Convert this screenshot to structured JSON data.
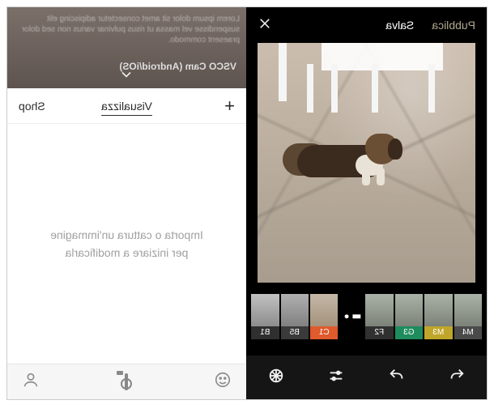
{
  "editor": {
    "header": {
      "draft_label": "Pubblica",
      "save_label": "Salva"
    },
    "filters": [
      {
        "code": "M4",
        "color": "#4a4a4a"
      },
      {
        "code": "M3",
        "color": "#bfa62a"
      },
      {
        "code": "G3",
        "color": "#1e8c5d"
      },
      {
        "code": "F2",
        "color": "#303030"
      },
      {
        "code": "C1",
        "color": "#df5a2c"
      },
      {
        "code": "B5",
        "color": "#3a3a3a"
      },
      {
        "code": "B1",
        "color": "#2f2f2f"
      }
    ],
    "toolbar_icons": [
      "undo",
      "redo",
      "adjustments",
      "presets"
    ]
  },
  "library": {
    "background_title": "VSCO Cam (Android/iOS)",
    "tabs": {
      "add": "+",
      "view": "Visualizza",
      "shop": "Shop"
    },
    "empty_line1": "Importa o cattura un'immagine",
    "empty_line2": "per iniziare a modificarla",
    "footer_icons": [
      "smiley",
      "camera",
      "profile"
    ]
  }
}
